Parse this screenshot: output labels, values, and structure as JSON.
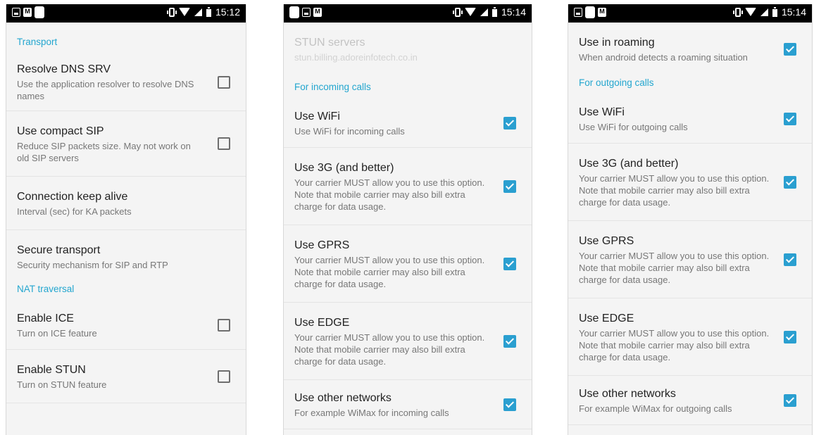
{
  "colors": {
    "accent": "#23a6cf",
    "checkbox_on": "#2a9fd0",
    "status_bar": "#000000"
  },
  "screens": [
    {
      "time": "15:12",
      "notification_icons": [
        "image-icon",
        "gmail-icon",
        "blank-notification-icon"
      ],
      "categories": {
        "transport": "Transport",
        "nat": "NAT traversal"
      },
      "items": [
        {
          "title": "Resolve DNS SRV",
          "summary": "Use the application resolver to resolve DNS names",
          "checked": false
        },
        {
          "title": "Use compact SIP",
          "summary": "Reduce SIP packets size. May not work on old SIP servers",
          "checked": false
        },
        {
          "title": "Connection keep alive",
          "summary": "Interval (sec) for KA packets"
        },
        {
          "title": "Secure transport",
          "summary": "Security mechanism for SIP and RTP"
        },
        {
          "title": "Enable ICE",
          "summary": "Turn on ICE feature",
          "checked": false
        },
        {
          "title": "Enable STUN",
          "summary": "Turn on STUN feature",
          "checked": false
        }
      ]
    },
    {
      "time": "15:14",
      "notification_icons": [
        "blank-notification-icon",
        "image-icon",
        "gmail-icon"
      ],
      "stun": {
        "title": "STUN servers",
        "summary": "stun.billing.adoreinfotech.co.in",
        "enabled": false
      },
      "category": "For incoming calls",
      "items": [
        {
          "title": "Use WiFi",
          "summary": "Use WiFi for incoming calls",
          "checked": true
        },
        {
          "title": "Use 3G (and better)",
          "summary": "Your carrier MUST allow you to use this option. Note that mobile carrier may also bill extra charge for data usage.",
          "checked": true
        },
        {
          "title": "Use GPRS",
          "summary": "Your carrier MUST allow you to use this option. Note that mobile carrier may also bill extra charge for data usage.",
          "checked": true
        },
        {
          "title": "Use EDGE",
          "summary": "Your carrier MUST allow you to use this option. Note that mobile carrier may also bill extra charge for data usage.",
          "checked": true
        },
        {
          "title": "Use other networks",
          "summary": "For example WiMax for incoming calls",
          "checked": true
        }
      ]
    },
    {
      "time": "15:14",
      "notification_icons": [
        "image-icon",
        "blank-notification-icon",
        "gmail-icon"
      ],
      "roaming": {
        "title": "Use in roaming",
        "summary": "When android detects a roaming situation",
        "checked": true
      },
      "category": "For outgoing calls",
      "items": [
        {
          "title": "Use WiFi",
          "summary": "Use WiFi for outgoing calls",
          "checked": true
        },
        {
          "title": "Use 3G (and better)",
          "summary": "Your carrier MUST allow you to use this option. Note that mobile carrier may also bill extra charge for data usage.",
          "checked": true
        },
        {
          "title": "Use GPRS",
          "summary": "Your carrier MUST allow you to use this option. Note that mobile carrier may also bill extra charge for data usage.",
          "checked": true
        },
        {
          "title": "Use EDGE",
          "summary": "Your carrier MUST allow you to use this option. Note that mobile carrier may also bill extra charge for data usage.",
          "checked": true
        },
        {
          "title": "Use other networks",
          "summary": "For example WiMax for outgoing calls",
          "checked": true
        }
      ]
    }
  ]
}
